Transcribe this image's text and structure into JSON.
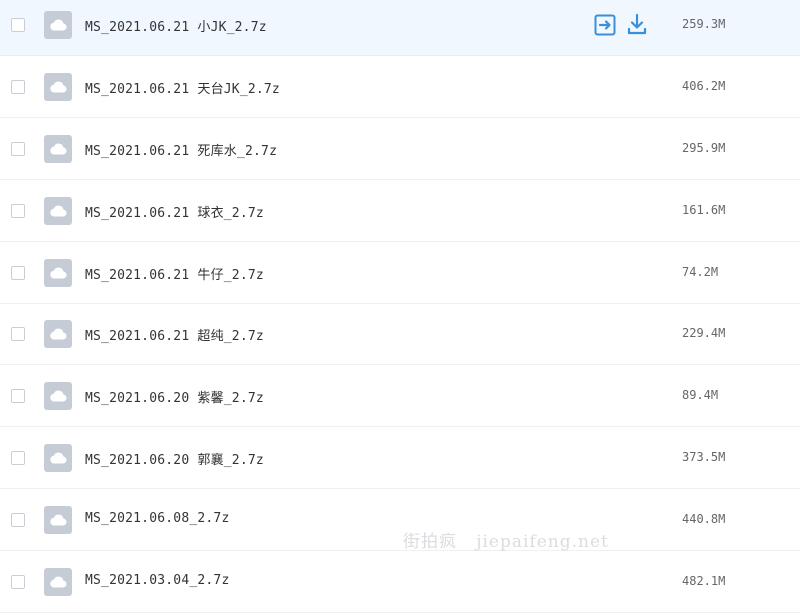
{
  "files": [
    {
      "name": "MS_2021.06.21 小JK_2.7z",
      "size": "259.3M",
      "hovered": true
    },
    {
      "name": "MS_2021.06.21 天台JK_2.7z",
      "size": "406.2M"
    },
    {
      "name": "MS_2021.06.21 死库水_2.7z",
      "size": "295.9M"
    },
    {
      "name": "MS_2021.06.21 球衣_2.7z",
      "size": "161.6M"
    },
    {
      "name": "MS_2021.06.21 牛仔_2.7z",
      "size": "74.2M"
    },
    {
      "name": "MS_2021.06.21 超纯_2.7z",
      "size": "229.4M"
    },
    {
      "name": "MS_2021.06.20 紫馨_2.7z",
      "size": "89.4M"
    },
    {
      "name": "MS_2021.06.20 郭襄_2.7z",
      "size": "373.5M"
    },
    {
      "name": "MS_2021.06.08_2.7z",
      "size": "440.8M"
    },
    {
      "name": "MS_2021.03.04_2.7z",
      "size": "482.1M"
    }
  ],
  "row_actions": {
    "share_icon": "share-icon",
    "download_icon": "download-icon"
  },
  "file_icon": "cloud-file-icon",
  "watermark": "街拍疯   jiepaifeng.net",
  "colors": {
    "accent": "#3b8fd9",
    "hover_row": "#f0f7ff",
    "file_icon_bg": "#c6ccd6",
    "text": "#333333",
    "size_text": "#666666"
  }
}
